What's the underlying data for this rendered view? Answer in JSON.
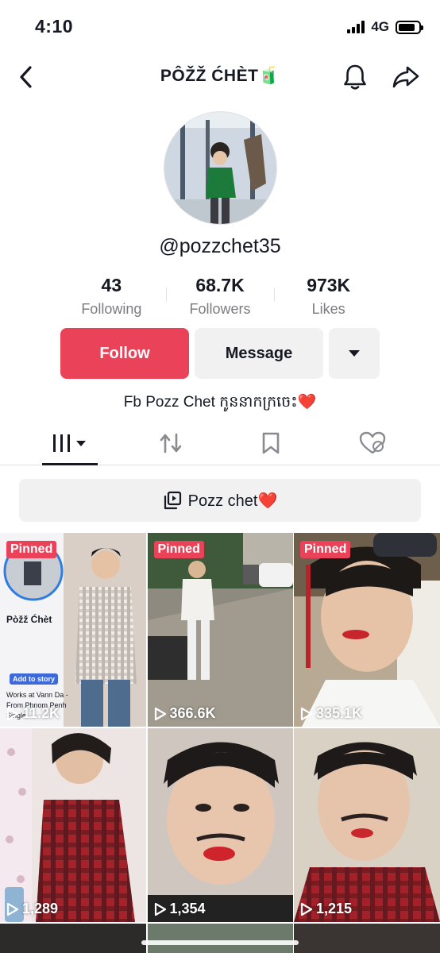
{
  "status": {
    "time": "4:10",
    "network": "4G",
    "battery_level": 0.85
  },
  "header": {
    "title": "PÔŽŽ ĆHÈT🧃",
    "back_icon": "chevron-left-icon",
    "bell_icon": "bell-icon",
    "share_icon": "share-arrow-icon"
  },
  "profile": {
    "username": "@pozzchet35",
    "stats": [
      {
        "value": "43",
        "label": "Following"
      },
      {
        "value": "68.7K",
        "label": "Followers"
      },
      {
        "value": "973K",
        "label": "Likes"
      }
    ],
    "follow_label": "Follow",
    "message_label": "Message",
    "bio": "Fb Pozz Chet កូននាកក្រចេះ❤️"
  },
  "tabs": [
    "videos-grid-icon",
    "repost-icon",
    "bookmark-icon",
    "liked-hidden-icon"
  ],
  "playlist": {
    "label": "Pozz chet❤️"
  },
  "videos": [
    {
      "pinned": "Pinned",
      "views": "11.2K",
      "overlay_name": "Pòžž Ćhèt",
      "overlay_button": "Add to story",
      "overlay_line1": "Works at Vann Da -",
      "overlay_line2": "From Phnom Penh",
      "overlay_line3": "Single"
    },
    {
      "pinned": "Pinned",
      "views": "366.6K"
    },
    {
      "pinned": "Pinned",
      "views": "335.1K"
    },
    {
      "pinned": "",
      "views": "1,289"
    },
    {
      "pinned": "",
      "views": "1,354"
    },
    {
      "pinned": "",
      "views": "1,215"
    }
  ],
  "colors": {
    "accent": "#ea4359",
    "button_gray": "#f1f1f2",
    "text_primary": "#161823",
    "text_secondary": "#7c7c80"
  }
}
